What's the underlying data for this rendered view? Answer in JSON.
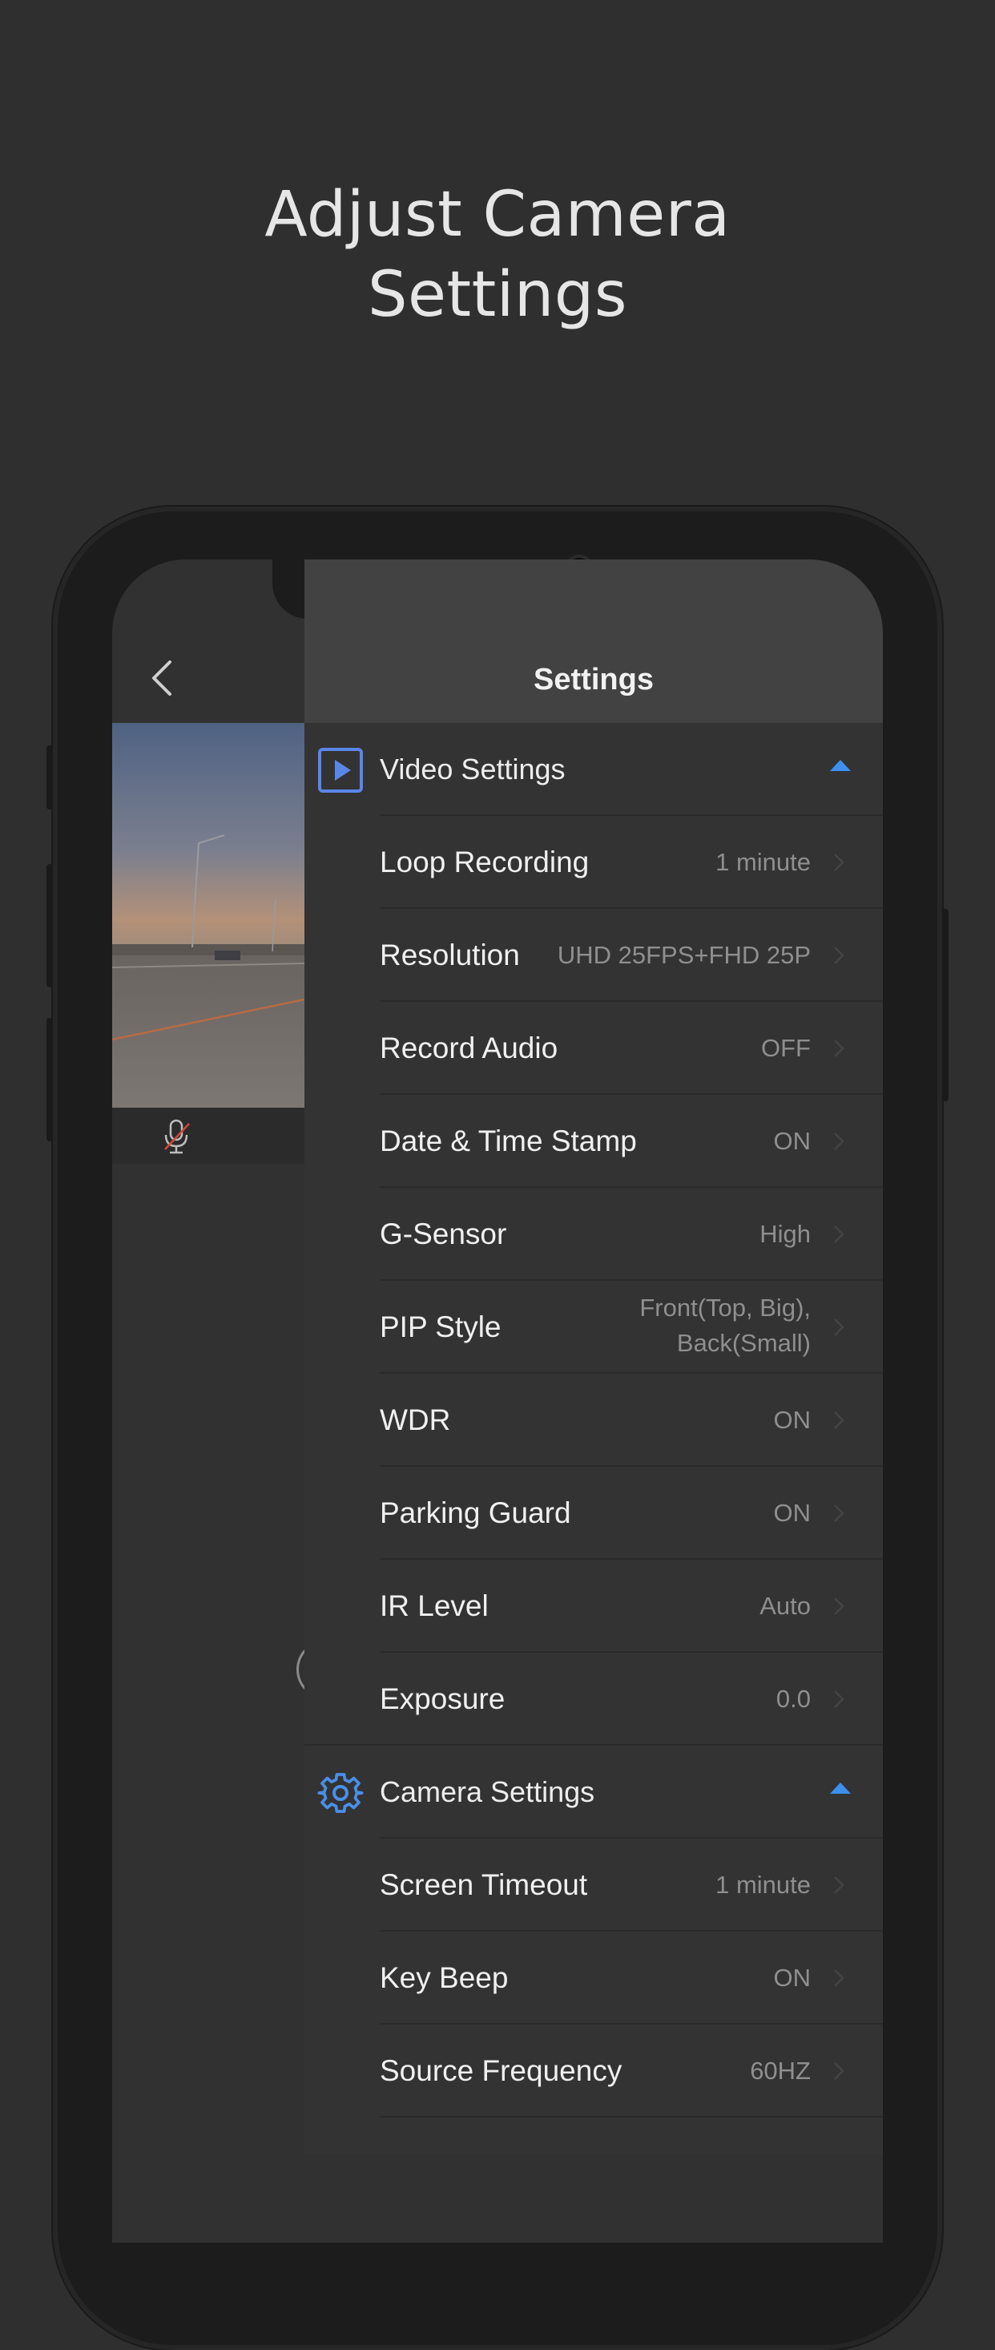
{
  "headline": {
    "line1": "Adjust Camera",
    "line2": "Settings"
  },
  "panel": {
    "title": "Settings"
  },
  "colors": {
    "background": "#2f2f2f",
    "accent": "#3d8ff0",
    "panel": "#333333",
    "header": "#424242"
  },
  "sections": [
    {
      "label": "Video Settings",
      "icon": "video-play-icon",
      "items": [
        {
          "label": "Loop Recording",
          "value": "1 minute"
        },
        {
          "label": "Resolution",
          "value": "UHD 25FPS+FHD 25P"
        },
        {
          "label": "Record Audio",
          "value": "OFF"
        },
        {
          "label": "Date & Time Stamp",
          "value": "ON"
        },
        {
          "label": "G-Sensor",
          "value": "High"
        },
        {
          "label": "PIP Style",
          "value": "Front(Top, Big),\nBack(Small)"
        },
        {
          "label": "WDR",
          "value": "ON"
        },
        {
          "label": "Parking Guard",
          "value": "ON"
        },
        {
          "label": "IR Level",
          "value": "Auto"
        },
        {
          "label": "Exposure",
          "value": "0.0"
        }
      ]
    },
    {
      "label": "Camera Settings",
      "icon": "gear-icon",
      "items": [
        {
          "label": "Screen Timeout",
          "value": "1 minute"
        },
        {
          "label": "Key Beep",
          "value": "ON"
        },
        {
          "label": "Source Frequency",
          "value": "60HZ"
        }
      ]
    }
  ]
}
